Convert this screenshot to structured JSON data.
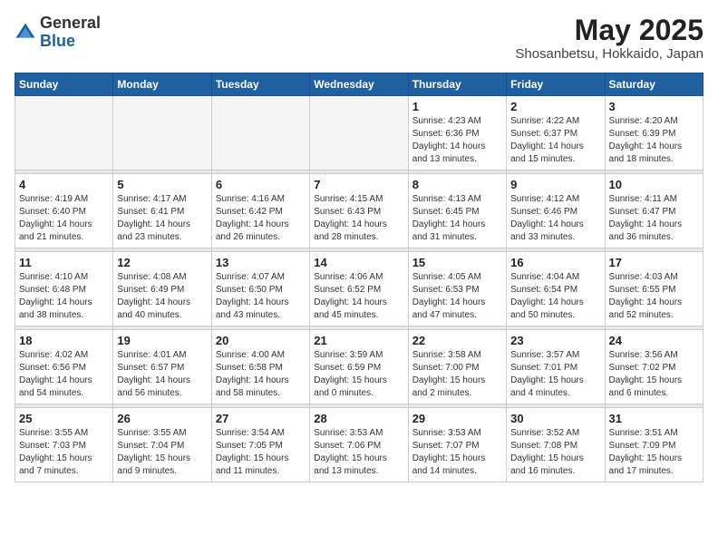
{
  "header": {
    "logo_general": "General",
    "logo_blue": "Blue",
    "month_year": "May 2025",
    "location": "Shosanbetsu, Hokkaido, Japan"
  },
  "weekdays": [
    "Sunday",
    "Monday",
    "Tuesday",
    "Wednesday",
    "Thursday",
    "Friday",
    "Saturday"
  ],
  "weeks": [
    [
      {
        "day": "",
        "info": ""
      },
      {
        "day": "",
        "info": ""
      },
      {
        "day": "",
        "info": ""
      },
      {
        "day": "",
        "info": ""
      },
      {
        "day": "1",
        "info": "Sunrise: 4:23 AM\nSunset: 6:36 PM\nDaylight: 14 hours\nand 13 minutes."
      },
      {
        "day": "2",
        "info": "Sunrise: 4:22 AM\nSunset: 6:37 PM\nDaylight: 14 hours\nand 15 minutes."
      },
      {
        "day": "3",
        "info": "Sunrise: 4:20 AM\nSunset: 6:39 PM\nDaylight: 14 hours\nand 18 minutes."
      }
    ],
    [
      {
        "day": "4",
        "info": "Sunrise: 4:19 AM\nSunset: 6:40 PM\nDaylight: 14 hours\nand 21 minutes."
      },
      {
        "day": "5",
        "info": "Sunrise: 4:17 AM\nSunset: 6:41 PM\nDaylight: 14 hours\nand 23 minutes."
      },
      {
        "day": "6",
        "info": "Sunrise: 4:16 AM\nSunset: 6:42 PM\nDaylight: 14 hours\nand 26 minutes."
      },
      {
        "day": "7",
        "info": "Sunrise: 4:15 AM\nSunset: 6:43 PM\nDaylight: 14 hours\nand 28 minutes."
      },
      {
        "day": "8",
        "info": "Sunrise: 4:13 AM\nSunset: 6:45 PM\nDaylight: 14 hours\nand 31 minutes."
      },
      {
        "day": "9",
        "info": "Sunrise: 4:12 AM\nSunset: 6:46 PM\nDaylight: 14 hours\nand 33 minutes."
      },
      {
        "day": "10",
        "info": "Sunrise: 4:11 AM\nSunset: 6:47 PM\nDaylight: 14 hours\nand 36 minutes."
      }
    ],
    [
      {
        "day": "11",
        "info": "Sunrise: 4:10 AM\nSunset: 6:48 PM\nDaylight: 14 hours\nand 38 minutes."
      },
      {
        "day": "12",
        "info": "Sunrise: 4:08 AM\nSunset: 6:49 PM\nDaylight: 14 hours\nand 40 minutes."
      },
      {
        "day": "13",
        "info": "Sunrise: 4:07 AM\nSunset: 6:50 PM\nDaylight: 14 hours\nand 43 minutes."
      },
      {
        "day": "14",
        "info": "Sunrise: 4:06 AM\nSunset: 6:52 PM\nDaylight: 14 hours\nand 45 minutes."
      },
      {
        "day": "15",
        "info": "Sunrise: 4:05 AM\nSunset: 6:53 PM\nDaylight: 14 hours\nand 47 minutes."
      },
      {
        "day": "16",
        "info": "Sunrise: 4:04 AM\nSunset: 6:54 PM\nDaylight: 14 hours\nand 50 minutes."
      },
      {
        "day": "17",
        "info": "Sunrise: 4:03 AM\nSunset: 6:55 PM\nDaylight: 14 hours\nand 52 minutes."
      }
    ],
    [
      {
        "day": "18",
        "info": "Sunrise: 4:02 AM\nSunset: 6:56 PM\nDaylight: 14 hours\nand 54 minutes."
      },
      {
        "day": "19",
        "info": "Sunrise: 4:01 AM\nSunset: 6:57 PM\nDaylight: 14 hours\nand 56 minutes."
      },
      {
        "day": "20",
        "info": "Sunrise: 4:00 AM\nSunset: 6:58 PM\nDaylight: 14 hours\nand 58 minutes."
      },
      {
        "day": "21",
        "info": "Sunrise: 3:59 AM\nSunset: 6:59 PM\nDaylight: 15 hours\nand 0 minutes."
      },
      {
        "day": "22",
        "info": "Sunrise: 3:58 AM\nSunset: 7:00 PM\nDaylight: 15 hours\nand 2 minutes."
      },
      {
        "day": "23",
        "info": "Sunrise: 3:57 AM\nSunset: 7:01 PM\nDaylight: 15 hours\nand 4 minutes."
      },
      {
        "day": "24",
        "info": "Sunrise: 3:56 AM\nSunset: 7:02 PM\nDaylight: 15 hours\nand 6 minutes."
      }
    ],
    [
      {
        "day": "25",
        "info": "Sunrise: 3:55 AM\nSunset: 7:03 PM\nDaylight: 15 hours\nand 7 minutes."
      },
      {
        "day": "26",
        "info": "Sunrise: 3:55 AM\nSunset: 7:04 PM\nDaylight: 15 hours\nand 9 minutes."
      },
      {
        "day": "27",
        "info": "Sunrise: 3:54 AM\nSunset: 7:05 PM\nDaylight: 15 hours\nand 11 minutes."
      },
      {
        "day": "28",
        "info": "Sunrise: 3:53 AM\nSunset: 7:06 PM\nDaylight: 15 hours\nand 13 minutes."
      },
      {
        "day": "29",
        "info": "Sunrise: 3:53 AM\nSunset: 7:07 PM\nDaylight: 15 hours\nand 14 minutes."
      },
      {
        "day": "30",
        "info": "Sunrise: 3:52 AM\nSunset: 7:08 PM\nDaylight: 15 hours\nand 16 minutes."
      },
      {
        "day": "31",
        "info": "Sunrise: 3:51 AM\nSunset: 7:09 PM\nDaylight: 15 hours\nand 17 minutes."
      }
    ]
  ]
}
